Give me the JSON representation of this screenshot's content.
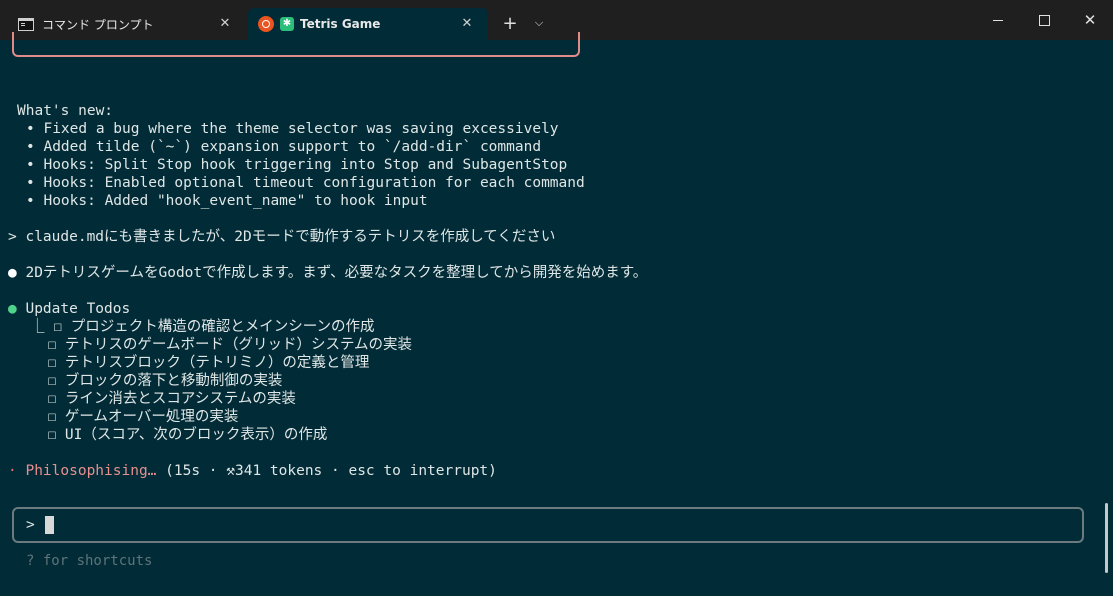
{
  "tabs": [
    {
      "label": "コマンド プロンプト",
      "icon": "cmd-icon",
      "active": false
    },
    {
      "label": "Tetris Game",
      "icon": "tetris-icon",
      "active": true
    }
  ],
  "titlebar": {
    "new_tab": "+",
    "dropdown": "⌵"
  },
  "terminal": {
    "whats_new_heading": "What's new:",
    "whats_new": [
      "Fixed a bug where the theme selector was saving excessively",
      "Added tilde (`~`) expansion support to `/add-dir` command",
      "Hooks: Split Stop hook triggering into Stop and SubagentStop",
      "Hooks: Enabled optional timeout configuration for each command",
      "Hooks: Added \"hook_event_name\" to hook input"
    ],
    "user_prompt": "claude.mdにも書きましたが、2Dモードで動作するテトリスを作成してください",
    "assistant_message": "2DテトリスゲームをGodotで作成します。まず、必要なタスクを整理してから開発を始めます。",
    "todos_title": "Update Todos",
    "todos": [
      "プロジェクト構造の確認とメインシーンの作成",
      "テトリスのゲームボード（グリッド）システムの実装",
      "テトリスブロック（テトリミノ）の定義と管理",
      "ブロックの落下と移動制御の実装",
      "ライン消去とスコアシステムの実装",
      "ゲームオーバー処理の実装",
      "UI（スコア、次のブロック表示）の作成"
    ],
    "status_word": "Philosophising…",
    "status_detail": " (15s · ⚒341 tokens · esc to interrupt)",
    "input_prompt": ">",
    "hint": "? for shortcuts"
  }
}
